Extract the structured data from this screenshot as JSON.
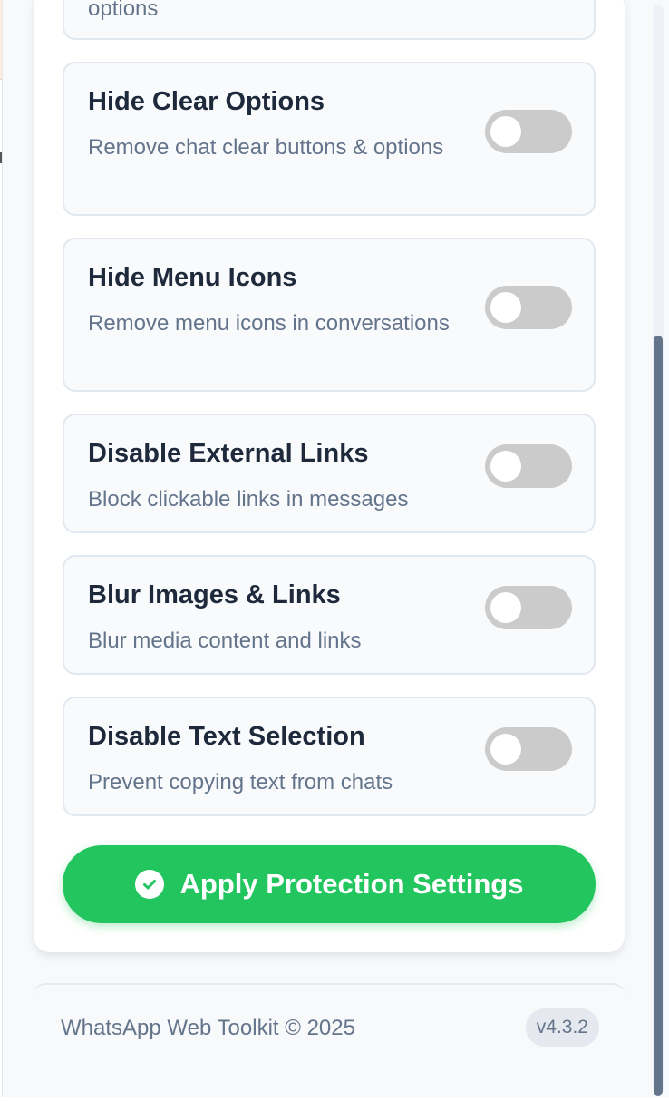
{
  "partial_option": {
    "desc_tail": "options"
  },
  "options": [
    {
      "title": "Hide Clear Options",
      "description": "Remove chat clear buttons & options",
      "enabled": false
    },
    {
      "title": "Hide Menu Icons",
      "description": "Remove menu icons in conversations",
      "enabled": false
    },
    {
      "title": "Disable External Links",
      "description": "Block clickable links in messages",
      "enabled": false
    },
    {
      "title": "Blur Images & Links",
      "description": "Blur media content and links",
      "enabled": false
    },
    {
      "title": "Disable Text Selection",
      "description": "Prevent copying text from chats",
      "enabled": false
    }
  ],
  "apply_button": {
    "label": "Apply Protection Settings",
    "icon": "check-circle-icon"
  },
  "footer": {
    "copyright": "WhatsApp Web Toolkit © 2025",
    "version": "v4.3.2"
  },
  "colors": {
    "accent": "#22c55e",
    "toggle_off": "#cbcbcb",
    "title_text": "#1e293b",
    "muted_text": "#64748b"
  }
}
